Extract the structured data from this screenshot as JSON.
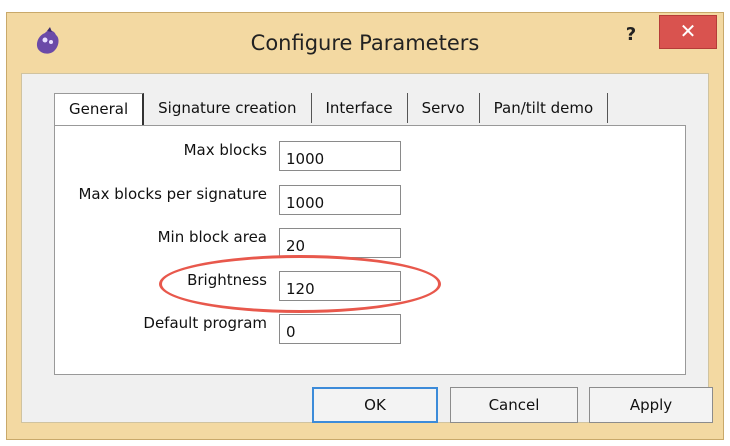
{
  "window": {
    "title": "Configure Parameters",
    "help_label": "?",
    "close_label": "✕"
  },
  "tabs": [
    {
      "label": "General"
    },
    {
      "label": "Signature creation"
    },
    {
      "label": "Interface"
    },
    {
      "label": "Servo"
    },
    {
      "label": "Pan/tilt demo"
    }
  ],
  "fields": [
    {
      "label": "Max blocks",
      "value": "1000"
    },
    {
      "label": "Max blocks per signature",
      "value": "1000"
    },
    {
      "label": "Min block area",
      "value": "20"
    },
    {
      "label": "Brightness",
      "value": "120"
    },
    {
      "label": "Default program",
      "value": "0"
    }
  ],
  "buttons": {
    "ok": "OK",
    "cancel": "Cancel",
    "apply": "Apply"
  },
  "colors": {
    "frame": "#f3d9a2",
    "close_button": "#d9534f",
    "highlight_ring": "#e8584c"
  }
}
